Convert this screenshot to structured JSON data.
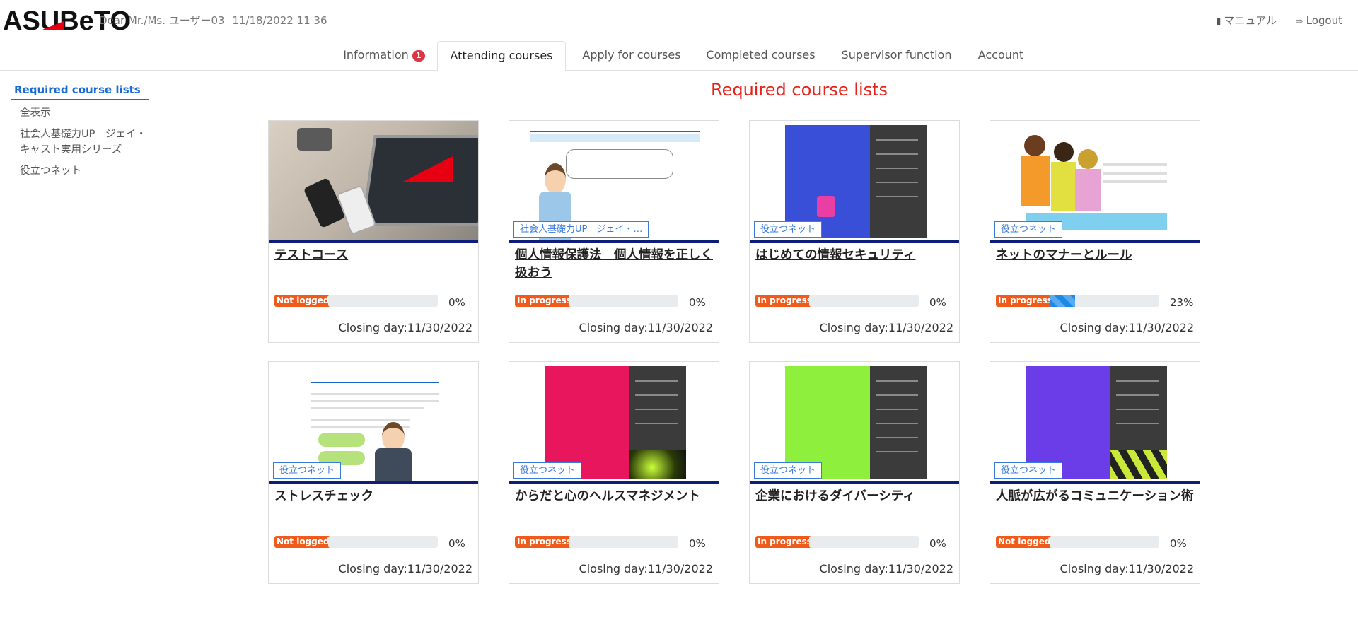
{
  "header": {
    "logo_text": "ASUBeTO",
    "greeting": "Dear Mr./Ms. ユーザー03",
    "datetime": "11/18/2022 11 36",
    "manual_label": "マニュアル",
    "logout_label": "Logout"
  },
  "tabs": [
    {
      "label": "Information",
      "badge": "1",
      "active": false
    },
    {
      "label": "Attending courses",
      "active": true
    },
    {
      "label": "Apply for courses",
      "active": false
    },
    {
      "label": "Completed courses",
      "active": false
    },
    {
      "label": "Supervisor function",
      "active": false
    },
    {
      "label": "Account",
      "active": false
    }
  ],
  "sidebar": {
    "title": "Required course lists",
    "items": [
      {
        "label": "全表示"
      },
      {
        "label": "社会人基礎力UP　ジェイ・キャスト実用シリーズ"
      },
      {
        "label": "役立つネット"
      }
    ]
  },
  "main": {
    "heading": "Required course lists",
    "courses": [
      {
        "title": "テストコース",
        "category": "",
        "status": "Not logged",
        "progress": 0,
        "progress_text": "0%",
        "closing": "Closing day:11/30/2022"
      },
      {
        "title": "個人情報保護法　個人情報を正しく扱おう",
        "category": "社会人基礎力UP　ジェイ・…",
        "status": "In progress",
        "progress": 0,
        "progress_text": "0%",
        "closing": "Closing day:11/30/2022"
      },
      {
        "title": "はじめての情報セキュリティ",
        "category": "役立つネット",
        "status": "In progress",
        "progress": 0,
        "progress_text": "0%",
        "closing": "Closing day:11/30/2022"
      },
      {
        "title": "ネットのマナーとルール",
        "category": "役立つネット",
        "status": "In progress",
        "progress": 23,
        "progress_text": "23%",
        "closing": "Closing day:11/30/2022"
      },
      {
        "title": "ストレスチェック",
        "category": "役立つネット",
        "status": "Not logged",
        "progress": 0,
        "progress_text": "0%",
        "closing": "Closing day:11/30/2022"
      },
      {
        "title": "からだと心のヘルスマネジメント",
        "category": "役立つネット",
        "status": "In progress",
        "progress": 0,
        "progress_text": "0%",
        "closing": "Closing day:11/30/2022"
      },
      {
        "title": "企業におけるダイバーシティ",
        "category": "役立つネット",
        "status": "In progress",
        "progress": 0,
        "progress_text": "0%",
        "closing": "Closing day:11/30/2022"
      },
      {
        "title": "人脈が広がるコミュニケーション術",
        "category": "役立つネット",
        "status": "Not logged",
        "progress": 0,
        "progress_text": "0%",
        "closing": "Closing day:11/30/2022"
      }
    ]
  },
  "colors": {
    "accent_red": "#e8221a",
    "link_blue": "#1b6bd6",
    "status_orange": "#f05a1a",
    "thumb_border_navy": "#0f1d7a"
  }
}
